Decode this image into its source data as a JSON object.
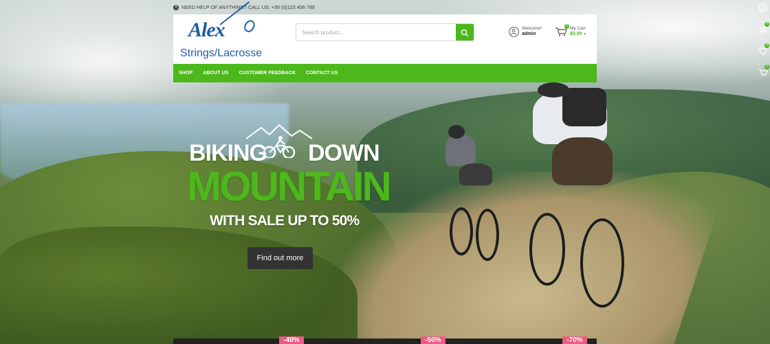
{
  "topbar": {
    "help_text": "NEED HELP OF ANYTHING? CALL US: +99 (0)123 456 789"
  },
  "logo": {
    "word1": "Alex",
    "word2": "Strings/Lacrosse"
  },
  "search": {
    "placeholder": "Search product..."
  },
  "account": {
    "welcome": "Welcome!",
    "user": "admin"
  },
  "cart": {
    "label": "My Cart",
    "total": "$0.00",
    "count": "0"
  },
  "nav": {
    "items": [
      "SHOP",
      "ABOUT US",
      "CUSTOMER FEEDBACK",
      "CONTACT US"
    ]
  },
  "side": {
    "compare_count": "0",
    "wishlist_count": "0",
    "cart_count": "0"
  },
  "hero": {
    "line1_left": "BIKING",
    "line1_right": "DOWN",
    "line2": "MOUNTAIN",
    "line3": "WITH SALE UP TO 50%",
    "cta": "Find out more"
  },
  "discounts": [
    "-40%",
    "-50%",
    "-70%"
  ],
  "colors": {
    "accent": "#4cb81c",
    "brand_blue": "#1f5da7",
    "sale_pink": "#ee5a84",
    "dark": "#333333"
  },
  "icons": [
    "help-icon",
    "search-icon",
    "user-icon",
    "basket-icon",
    "chevron-down-icon",
    "account-icon",
    "compare-icon",
    "heart-icon",
    "cart-icon",
    "mountain-bike-icon"
  ]
}
